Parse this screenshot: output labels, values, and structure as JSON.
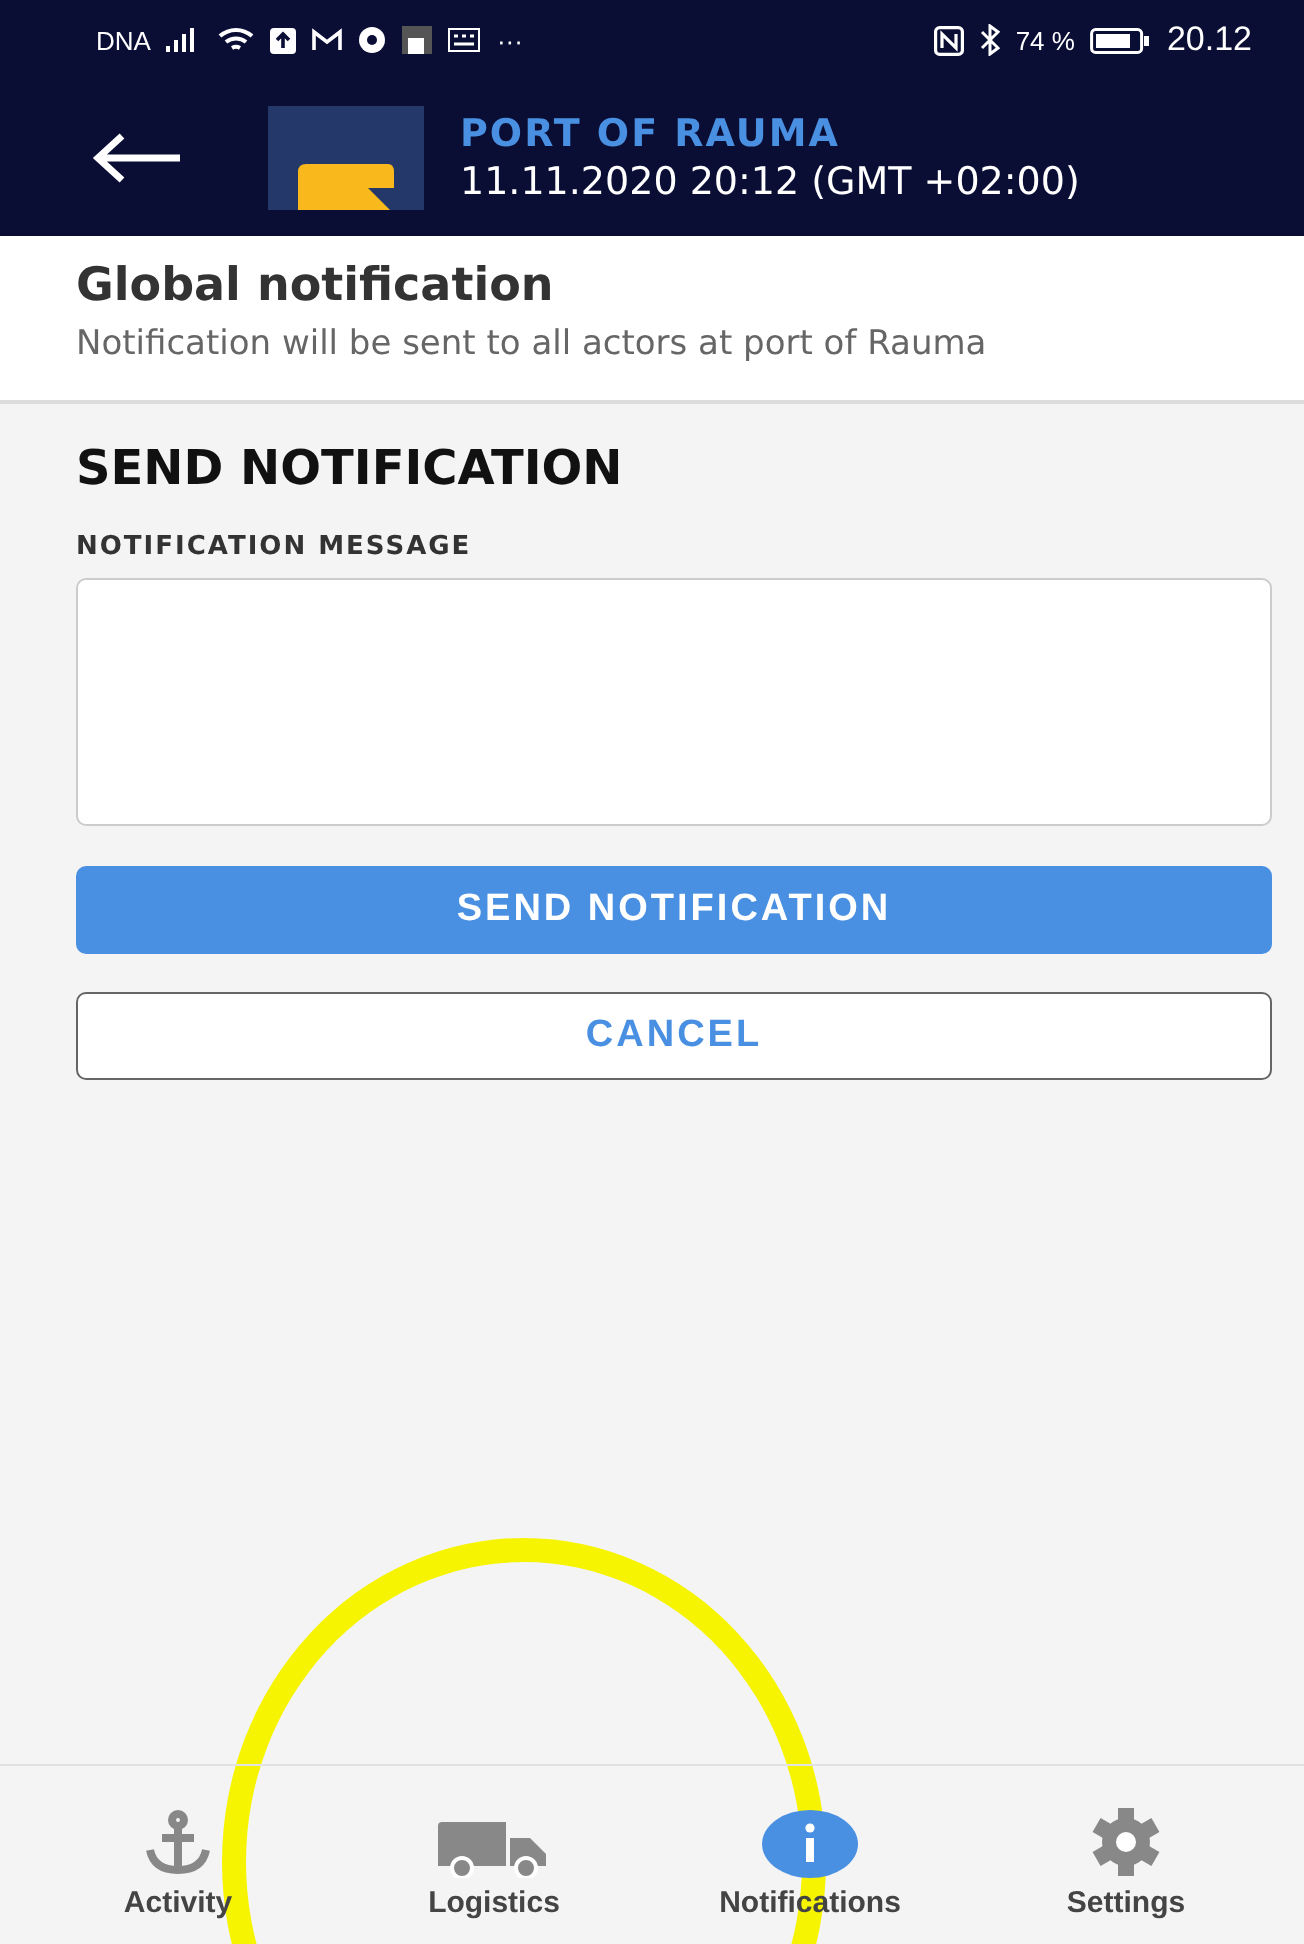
{
  "status_bar": {
    "carrier": "DNA",
    "more": "···",
    "battery": "74 %",
    "time": "20.12"
  },
  "header": {
    "title": "PORT OF RAUMA",
    "datetime": "11.11.2020 20:12 (GMT +02:00)"
  },
  "intro": {
    "title": "Global notification",
    "description": "Notification will be sent to all actors at port of Rauma"
  },
  "form": {
    "heading": "SEND NOTIFICATION",
    "field_label": "NOTIFICATION MESSAGE",
    "buttons": [
      {
        "label": "SEND NOTIFICATION",
        "kind": "primary"
      },
      {
        "label": "CANCEL",
        "kind": "outline"
      }
    ]
  },
  "bottom_nav": [
    {
      "label": "Activity",
      "kind": "anchor",
      "selected": false
    },
    {
      "label": "Logistics",
      "kind": "truck",
      "selected": false
    },
    {
      "label": "Notifications",
      "kind": "info",
      "selected": true
    },
    {
      "label": "Settings",
      "kind": "gear",
      "selected": false
    }
  ]
}
